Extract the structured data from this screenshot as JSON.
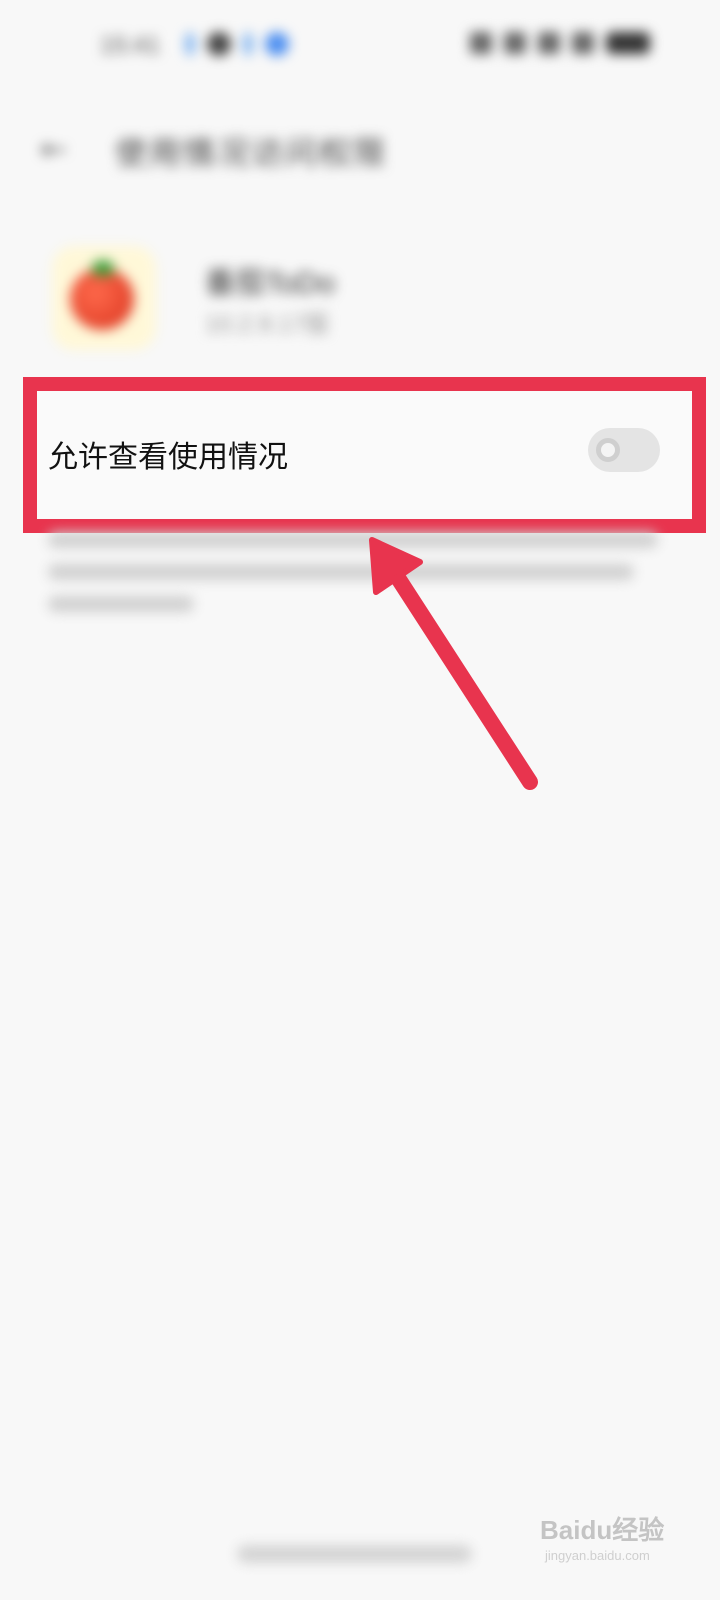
{
  "status_bar": {
    "time": "15:41"
  },
  "header": {
    "back_icon": "←",
    "title": "使用情况访问权限"
  },
  "app": {
    "name": "番茄ToDo",
    "version": "10.2.9.17版"
  },
  "setting": {
    "label": "允许查看使用情况",
    "enabled": false
  },
  "annotation": {
    "box_color": "#e8344e",
    "arrow_color": "#e8344e"
  },
  "watermark": {
    "text": "Baidu经验",
    "sub": "jingyan.baidu.com"
  },
  "colors": {
    "background": "#f8f8f8",
    "accent": "#e8344e"
  }
}
